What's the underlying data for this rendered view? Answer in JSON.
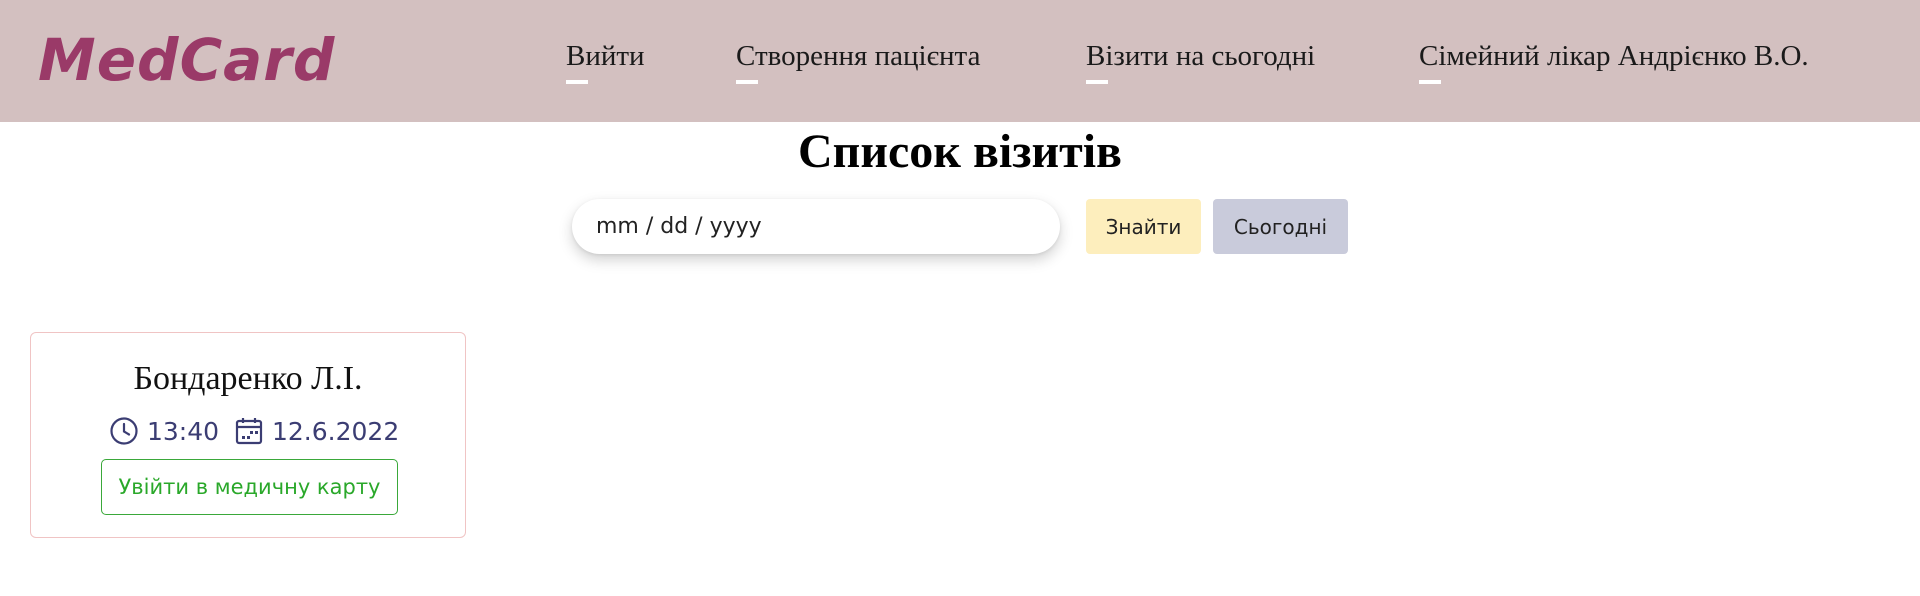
{
  "header": {
    "logo": "MedCard",
    "nav": [
      {
        "label": "Вийти"
      },
      {
        "label": "Створення пацієнта"
      },
      {
        "label": "Візити на сьогодні"
      },
      {
        "label": "Сімейний лікар Андрієнко В.О."
      }
    ]
  },
  "main": {
    "title": "Список візитів",
    "search": {
      "placeholder": "mm / dd / yyyy",
      "value": "",
      "find_label": "Знайти",
      "today_label": "Сьогодні"
    },
    "visits": [
      {
        "patient": "Бондаренко Л.І.",
        "time": "13:40",
        "date": "12.6.2022",
        "open_card_label": "Увійти в медичну карту",
        "time_icon": "clock-icon",
        "date_icon": "calendar-icon"
      }
    ]
  },
  "colors": {
    "header_bg": "#d3c0c0",
    "logo": "#9a3a68",
    "find_button": "#fdeebd",
    "today_button": "#c9cbdb",
    "card_border": "#f0c4c4",
    "card_button": "#2aa82a",
    "meta_text": "#3b3d73"
  }
}
